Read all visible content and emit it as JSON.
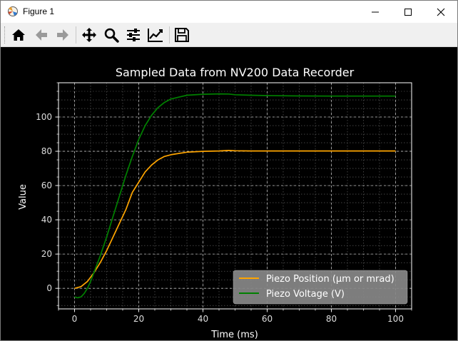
{
  "window": {
    "title": "Figure 1",
    "minimize_icon": "minimize-icon",
    "maximize_icon": "maximize-icon",
    "close_icon": "close-icon"
  },
  "toolbar": {
    "buttons": [
      {
        "name": "home",
        "icon": "home-icon"
      },
      {
        "name": "back",
        "icon": "arrow-left-icon"
      },
      {
        "name": "forward",
        "icon": "arrow-right-icon"
      },
      {
        "name": "pan",
        "icon": "move-icon"
      },
      {
        "name": "zoom",
        "icon": "magnifier-icon"
      },
      {
        "name": "configure-subplots",
        "icon": "sliders-icon"
      },
      {
        "name": "edit-axis",
        "icon": "line-chart-icon"
      },
      {
        "name": "save",
        "icon": "floppy-disk-icon"
      }
    ]
  },
  "chart_data": {
    "type": "line",
    "title": "Sampled Data from NV200 Data Recorder",
    "xlabel": "Time (ms)",
    "ylabel": "Value",
    "xlim": [
      -5,
      105
    ],
    "ylim": [
      -12,
      120
    ],
    "xticks": [
      0,
      20,
      40,
      60,
      80,
      100
    ],
    "yticks": [
      0,
      20,
      40,
      60,
      80,
      100
    ],
    "grid": true,
    "legend_position": "lower right",
    "background": "#000000",
    "series": [
      {
        "name": "Piezo Position (µm or mrad)",
        "color": "#ffa500",
        "x": [
          0,
          2,
          4,
          6,
          8,
          10,
          12,
          14,
          16,
          17,
          18,
          19,
          20,
          22,
          24,
          26,
          28,
          30,
          35,
          40,
          45,
          48,
          50,
          55,
          60,
          70,
          80,
          90,
          100
        ],
        "y": [
          0,
          1,
          4,
          9,
          15,
          22,
          30,
          38,
          46,
          51,
          56,
          59,
          62,
          68,
          72,
          75,
          77,
          78,
          79.5,
          80,
          80.2,
          80.5,
          80.3,
          80.2,
          80.2,
          80.2,
          80.2,
          80.2,
          80.2
        ]
      },
      {
        "name": "Piezo Voltage (V)",
        "color": "#008000",
        "x": [
          0,
          1,
          2,
          3,
          4,
          5,
          6,
          8,
          10,
          12,
          14,
          16,
          18,
          20,
          22,
          24,
          26,
          28,
          30,
          35,
          40,
          45,
          48,
          50,
          55,
          60,
          70,
          80,
          90,
          100
        ],
        "y": [
          -5,
          -5.5,
          -5,
          -3,
          0,
          4,
          9,
          19,
          30,
          42,
          54,
          66,
          77,
          87,
          95,
          101,
          105.5,
          108.5,
          110.5,
          112.7,
          113.3,
          113.5,
          113.4,
          113,
          112.7,
          112.5,
          112.3,
          112.2,
          112.2,
          112.2
        ]
      }
    ]
  }
}
